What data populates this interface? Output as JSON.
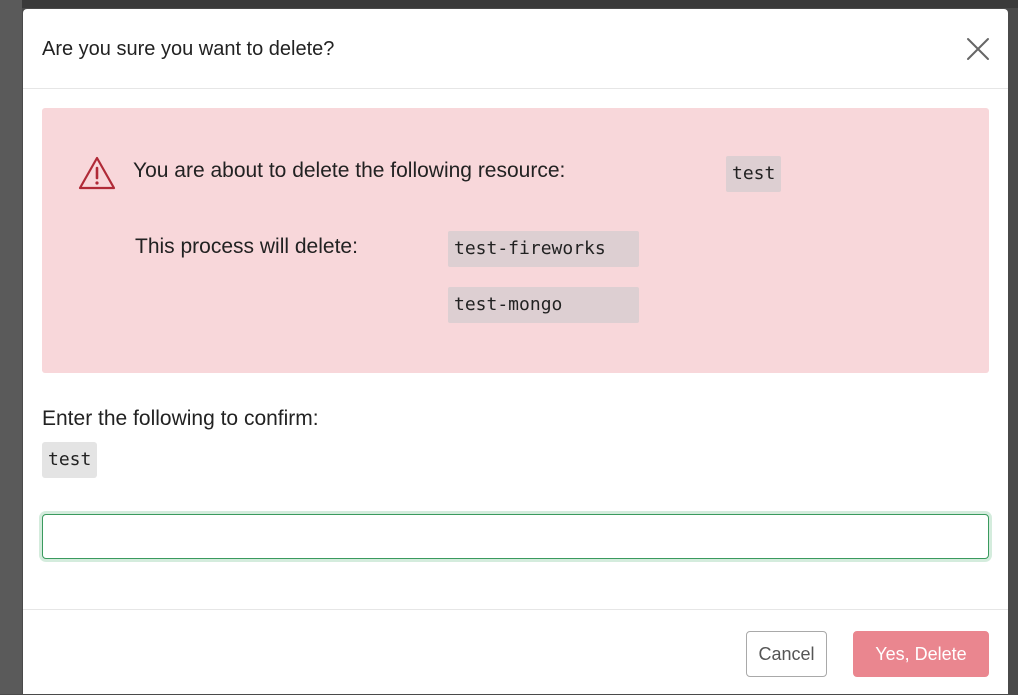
{
  "dialog": {
    "title": "Are you sure you want to delete?",
    "close_icon": "close-icon"
  },
  "alert": {
    "icon": "warning-icon",
    "message": "You are about to delete the following resource:",
    "resource": "test",
    "process_label": "This process will delete:",
    "items": [
      "test-fireworks",
      "test-mongo"
    ]
  },
  "confirm": {
    "label": "Enter the following to confirm:",
    "code": "test",
    "input_value": "",
    "placeholder": ""
  },
  "footer": {
    "cancel_label": "Cancel",
    "delete_label": "Yes, Delete"
  },
  "colors": {
    "alert_bg": "#f8d7da",
    "danger_button": "#ea868f",
    "input_focus": "#3a9a5e",
    "warning_icon": "#b02a37"
  }
}
